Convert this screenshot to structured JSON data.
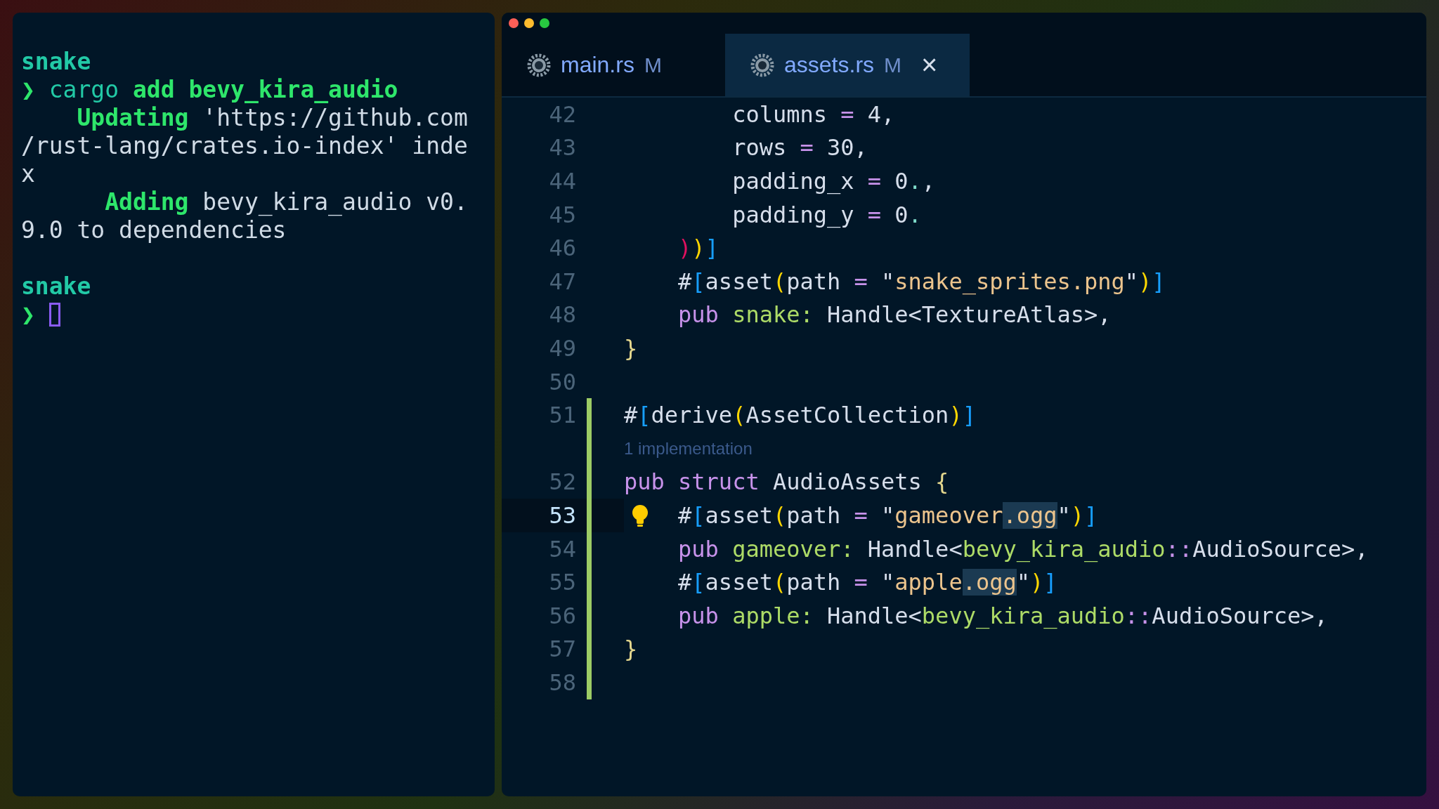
{
  "terminal": {
    "blocks": [
      {
        "lines": [
          [
            {
              "text": "snake",
              "kind": "dir"
            }
          ],
          [
            {
              "text": "❯ ",
              "kind": "prompt"
            },
            {
              "text": "cargo ",
              "kind": "command"
            },
            {
              "text": "add bevy_kira_audio",
              "kind": "arg"
            }
          ],
          [
            {
              "text": "    Updating",
              "kind": "status"
            },
            {
              "text": " 'https://github.com",
              "kind": "plain"
            }
          ],
          [
            {
              "text": "/rust-lang/crates.io-index' inde",
              "kind": "plain"
            }
          ],
          [
            {
              "text": "x",
              "kind": "plain"
            }
          ],
          [
            {
              "text": "      Adding",
              "kind": "status"
            },
            {
              "text": " bevy_kira_audio v0.",
              "kind": "plain"
            }
          ],
          [
            {
              "text": "9.0 to dependencies",
              "kind": "plain"
            }
          ]
        ]
      },
      {
        "lines": [
          [
            {
              "text": "snake",
              "kind": "dir"
            }
          ],
          [
            {
              "text": "❯ ",
              "kind": "prompt"
            }
          ]
        ]
      }
    ],
    "cursor_visible": true
  },
  "editor": {
    "tabs": [
      {
        "label": "main.rs",
        "badge": "M",
        "selected": false
      },
      {
        "label": "assets.rs",
        "badge": "M",
        "close": "×",
        "selected": true
      }
    ],
    "lines": [
      {
        "kind": "code",
        "number": "42",
        "modified": false,
        "current": false,
        "lightbulb": false,
        "tokens": [
          {
            "text": "        columns ",
            "kind": "plain"
          },
          {
            "text": "=",
            "kind": "operator"
          },
          {
            "text": " 4,",
            "kind": "plain"
          }
        ]
      },
      {
        "kind": "code",
        "number": "43",
        "modified": false,
        "current": false,
        "lightbulb": false,
        "tokens": [
          {
            "text": "        rows ",
            "kind": "plain"
          },
          {
            "text": "=",
            "kind": "operator"
          },
          {
            "text": " 30,",
            "kind": "plain"
          }
        ]
      },
      {
        "kind": "code",
        "number": "44",
        "modified": false,
        "current": false,
        "lightbulb": false,
        "tokens": [
          {
            "text": "        padding_x ",
            "kind": "plain"
          },
          {
            "text": "=",
            "kind": "operator"
          },
          {
            "text": " 0",
            "kind": "plain"
          },
          {
            "text": ".",
            "kind": "dot"
          },
          {
            "text": ",",
            "kind": "plain"
          }
        ]
      },
      {
        "kind": "code",
        "number": "45",
        "modified": false,
        "current": false,
        "lightbulb": false,
        "tokens": [
          {
            "text": "        padding_y ",
            "kind": "plain"
          },
          {
            "text": "=",
            "kind": "operator"
          },
          {
            "text": " 0",
            "kind": "plain"
          },
          {
            "text": ".",
            "kind": "dot"
          }
        ]
      },
      {
        "kind": "code",
        "number": "46",
        "modified": false,
        "current": false,
        "lightbulb": false,
        "tokens": [
          {
            "text": "    )",
            "kind": "bracket3"
          },
          {
            "text": ")",
            "kind": "bracket1"
          },
          {
            "text": "]",
            "kind": "bracket2"
          }
        ]
      },
      {
        "kind": "code",
        "number": "47",
        "modified": false,
        "current": false,
        "lightbulb": false,
        "tokens": [
          {
            "text": "    #",
            "kind": "plain"
          },
          {
            "text": "[",
            "kind": "bracket2"
          },
          {
            "text": "asset",
            "kind": "plain"
          },
          {
            "text": "(",
            "kind": "bracket1"
          },
          {
            "text": "path ",
            "kind": "plain"
          },
          {
            "text": "=",
            "kind": "operator"
          },
          {
            "text": " \"",
            "kind": "plain"
          },
          {
            "text": "snake_sprites.png",
            "kind": "string"
          },
          {
            "text": "\"",
            "kind": "plain"
          },
          {
            "text": ")",
            "kind": "bracket1"
          },
          {
            "text": "]",
            "kind": "bracket2"
          }
        ]
      },
      {
        "kind": "code",
        "number": "48",
        "modified": false,
        "current": false,
        "lightbulb": false,
        "tokens": [
          {
            "text": "    pub ",
            "kind": "keyword"
          },
          {
            "text": "snake:",
            "kind": "field"
          },
          {
            "text": " Handle<TextureAtlas>,",
            "kind": "plain"
          }
        ]
      },
      {
        "kind": "code",
        "number": "49",
        "modified": false,
        "current": false,
        "lightbulb": false,
        "tokens": [
          {
            "text": "}",
            "kind": "brace"
          }
        ]
      },
      {
        "kind": "code",
        "number": "50",
        "modified": false,
        "current": false,
        "lightbulb": false
      },
      {
        "kind": "code",
        "number": "51",
        "modified": true,
        "current": false,
        "lightbulb": false,
        "tokens": [
          {
            "text": "#",
            "kind": "plain"
          },
          {
            "text": "[",
            "kind": "bracket2"
          },
          {
            "text": "derive",
            "kind": "plain"
          },
          {
            "text": "(",
            "kind": "bracket1"
          },
          {
            "text": "AssetCollection",
            "kind": "plain"
          },
          {
            "text": ")",
            "kind": "bracket1"
          },
          {
            "text": "]",
            "kind": "bracket2"
          }
        ]
      },
      {
        "kind": "codelens",
        "text": "1 implementation",
        "modified": true
      },
      {
        "kind": "code",
        "number": "52",
        "modified": true,
        "current": false,
        "lightbulb": false,
        "tokens": [
          {
            "text": "pub struct ",
            "kind": "keyword"
          },
          {
            "text": "AudioAssets ",
            "kind": "plain"
          },
          {
            "text": "{",
            "kind": "brace"
          }
        ]
      },
      {
        "kind": "code",
        "number": "53",
        "modified": true,
        "current": true,
        "lightbulb": true,
        "tokens": [
          {
            "text": "    #",
            "kind": "plain"
          },
          {
            "text": "[",
            "kind": "bracket2"
          },
          {
            "text": "asset",
            "kind": "plain"
          },
          {
            "text": "(",
            "kind": "bracket1"
          },
          {
            "text": "path ",
            "kind": "plain"
          },
          {
            "text": "=",
            "kind": "operator"
          },
          {
            "text": " \"",
            "kind": "plain"
          },
          {
            "text": "gameover",
            "kind": "string"
          },
          {
            "text": ".ogg",
            "kind": "string-match"
          },
          {
            "text": "\"",
            "kind": "plain"
          },
          {
            "text": ")",
            "kind": "bracket1"
          },
          {
            "text": "]",
            "kind": "bracket2"
          }
        ]
      },
      {
        "kind": "code",
        "number": "54",
        "modified": true,
        "current": false,
        "lightbulb": false,
        "tokens": [
          {
            "text": "    pub ",
            "kind": "keyword"
          },
          {
            "text": "gameover:",
            "kind": "field"
          },
          {
            "text": " Handle<",
            "kind": "plain"
          },
          {
            "text": "bevy_kira_audio",
            "kind": "field"
          },
          {
            "text": "::",
            "kind": "operator"
          },
          {
            "text": "AudioSource>,",
            "kind": "plain"
          }
        ]
      },
      {
        "kind": "code",
        "number": "55",
        "modified": true,
        "current": false,
        "lightbulb": false,
        "tokens": [
          {
            "text": "    #",
            "kind": "plain"
          },
          {
            "text": "[",
            "kind": "bracket2"
          },
          {
            "text": "asset",
            "kind": "plain"
          },
          {
            "text": "(",
            "kind": "bracket1"
          },
          {
            "text": "path ",
            "kind": "plain"
          },
          {
            "text": "=",
            "kind": "operator"
          },
          {
            "text": " \"",
            "kind": "plain"
          },
          {
            "text": "apple",
            "kind": "string"
          },
          {
            "text": ".ogg",
            "kind": "string-match"
          },
          {
            "text": "\"",
            "kind": "plain"
          },
          {
            "text": ")",
            "kind": "bracket1"
          },
          {
            "text": "]",
            "kind": "bracket2"
          }
        ]
      },
      {
        "kind": "code",
        "number": "56",
        "modified": true,
        "current": false,
        "lightbulb": false,
        "tokens": [
          {
            "text": "    pub ",
            "kind": "keyword"
          },
          {
            "text": "apple:",
            "kind": "field"
          },
          {
            "text": " Handle<",
            "kind": "plain"
          },
          {
            "text": "bevy_kira_audio",
            "kind": "field"
          },
          {
            "text": "::",
            "kind": "operator"
          },
          {
            "text": "AudioSource>,",
            "kind": "plain"
          }
        ]
      },
      {
        "kind": "code",
        "number": "57",
        "modified": true,
        "current": false,
        "lightbulb": false,
        "tokens": [
          {
            "text": "}",
            "kind": "brace"
          }
        ]
      },
      {
        "kind": "code",
        "number": "58",
        "modified": true,
        "current": false,
        "lightbulb": false
      }
    ]
  }
}
